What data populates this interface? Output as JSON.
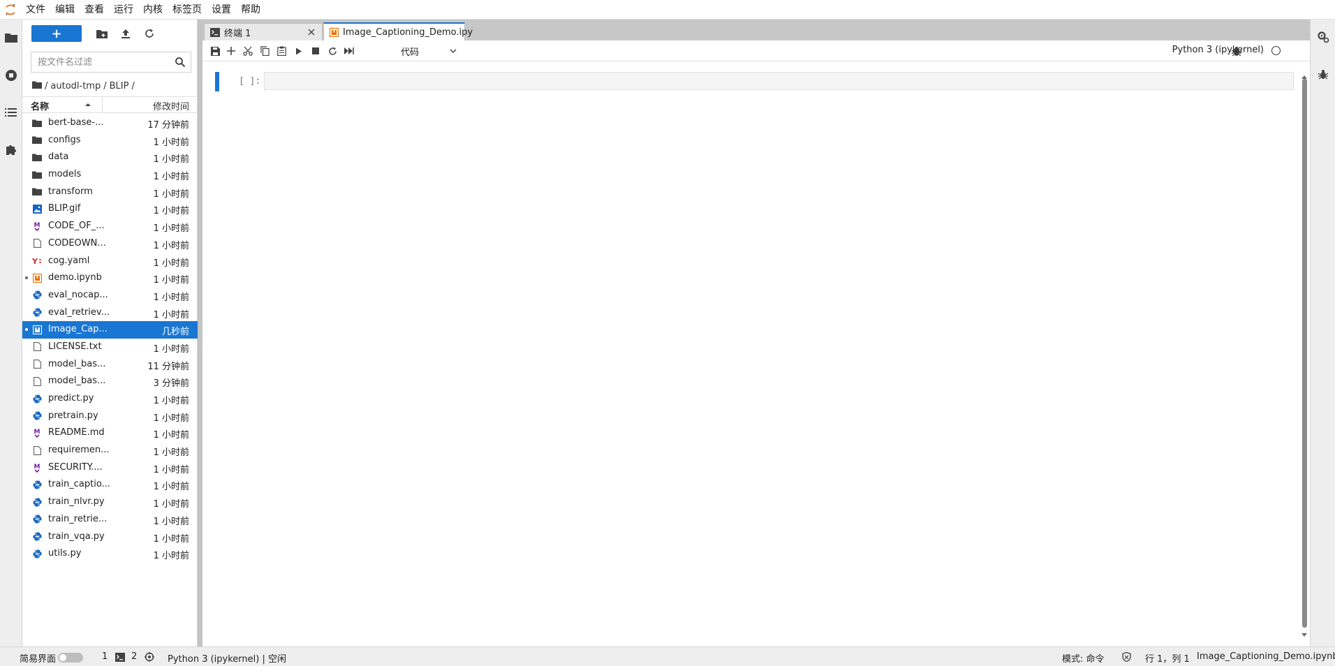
{
  "menubar": {
    "items": [
      "文件",
      "编辑",
      "查看",
      "运行",
      "内核",
      "标签页",
      "设置",
      "帮助"
    ]
  },
  "filebrowser": {
    "new_label": "+",
    "filter_placeholder": "按文件名过滤",
    "breadcrumb": [
      "/",
      "autodl-tmp",
      "/",
      "BLIP",
      "/"
    ],
    "header": {
      "name": "名称",
      "modified": "修改时间"
    },
    "files": [
      {
        "name": "bert-base-...",
        "modified": "17 分钟前",
        "type": "folder"
      },
      {
        "name": "configs",
        "modified": "1 小时前",
        "type": "folder"
      },
      {
        "name": "data",
        "modified": "1 小时前",
        "type": "folder"
      },
      {
        "name": "models",
        "modified": "1 小时前",
        "type": "folder"
      },
      {
        "name": "transform",
        "modified": "1 小时前",
        "type": "folder"
      },
      {
        "name": "BLIP.gif",
        "modified": "1 小时前",
        "type": "image"
      },
      {
        "name": "CODE_OF_...",
        "modified": "1 小时前",
        "type": "markdown"
      },
      {
        "name": "CODEOWN...",
        "modified": "1 小时前",
        "type": "file"
      },
      {
        "name": "cog.yaml",
        "modified": "1 小时前",
        "type": "yaml"
      },
      {
        "name": "demo.ipynb",
        "modified": "1 小时前",
        "type": "notebook",
        "running": true
      },
      {
        "name": "eval_nocap...",
        "modified": "1 小时前",
        "type": "python"
      },
      {
        "name": "eval_retriev...",
        "modified": "1 小时前",
        "type": "python"
      },
      {
        "name": "Image_Cap...",
        "modified": "几秒前",
        "type": "notebook",
        "running": true,
        "selected": true
      },
      {
        "name": "LICENSE.txt",
        "modified": "1 小时前",
        "type": "file"
      },
      {
        "name": "model_bas...",
        "modified": "11 分钟前",
        "type": "file"
      },
      {
        "name": "model_bas...",
        "modified": "3 分钟前",
        "type": "file"
      },
      {
        "name": "predict.py",
        "modified": "1 小时前",
        "type": "python"
      },
      {
        "name": "pretrain.py",
        "modified": "1 小时前",
        "type": "python"
      },
      {
        "name": "README.md",
        "modified": "1 小时前",
        "type": "markdown"
      },
      {
        "name": "requiremen...",
        "modified": "1 小时前",
        "type": "file"
      },
      {
        "name": "SECURITY....",
        "modified": "1 小时前",
        "type": "markdown"
      },
      {
        "name": "train_captio...",
        "modified": "1 小时前",
        "type": "python"
      },
      {
        "name": "train_nlvr.py",
        "modified": "1 小时前",
        "type": "python"
      },
      {
        "name": "train_retrie...",
        "modified": "1 小时前",
        "type": "python"
      },
      {
        "name": "train_vqa.py",
        "modified": "1 小时前",
        "type": "python"
      },
      {
        "name": "utils.py",
        "modified": "1 小时前",
        "type": "python"
      }
    ]
  },
  "tabs": [
    {
      "label": "终端 1",
      "icon": "terminal-icon",
      "active": false
    },
    {
      "label": "Image_Captioning_Demo.ipy",
      "icon": "notebook-icon",
      "active": true,
      "unsaved": true
    }
  ],
  "notebook_toolbar": {
    "cell_type": "代码",
    "kernel_name": "Python 3 (ipykernel)"
  },
  "cell": {
    "prompt": "[ ]:",
    "source": ""
  },
  "statusbar": {
    "simple_mode": "简易界面",
    "simple_mode_on": false,
    "count_1": "1",
    "count_2": "2",
    "kernel_status": "Python 3 (ipykernel) | 空闲",
    "mode": "模式: 命令",
    "position": "行 1，列 1",
    "filename": "Image_Captioning_Demo.ipynb"
  },
  "colors": {
    "accent": "#1976d2",
    "python": "#1565c0",
    "markdown": "#7b1fa2",
    "notebook": "#ef6c00",
    "yaml": "#d32f2f"
  }
}
